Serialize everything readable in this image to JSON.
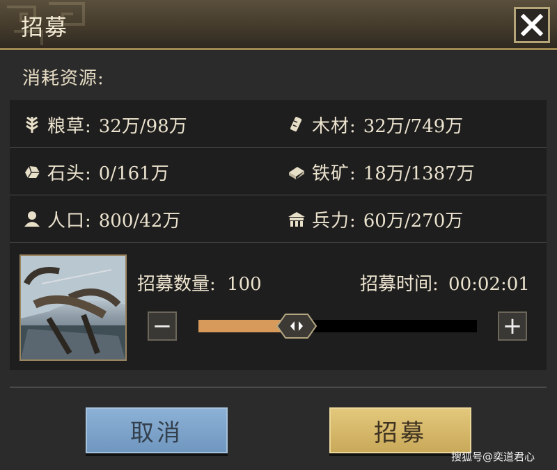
{
  "window": {
    "title": "招募",
    "close_icon": "close-icon"
  },
  "subtitle": "消耗资源:",
  "resources": [
    {
      "label": "粮草:",
      "value": "32万/98万",
      "icon": "wheat-icon"
    },
    {
      "label": "木材:",
      "value": "32万/749万",
      "icon": "wood-icon"
    },
    {
      "label": "石头:",
      "value": "0/161万",
      "icon": "stone-icon"
    },
    {
      "label": "铁矿:",
      "value": "18万/1387万",
      "icon": "iron-icon"
    },
    {
      "label": "人口:",
      "value": "800/42万",
      "icon": "person-icon"
    },
    {
      "label": "兵力:",
      "value": "60万/270万",
      "icon": "barracks-icon"
    }
  ],
  "recruit": {
    "count_label": "招募数量:",
    "count_value": "100",
    "time_label": "招募时间:",
    "time_value": "00:02:01",
    "slider_fraction": 0.3,
    "minus_label": "−",
    "plus_label": "+"
  },
  "buttons": {
    "cancel": "取消",
    "confirm": "招募"
  },
  "watermark": "搜狐号@奕道君心",
  "colors": {
    "slider_fill": "#d79a5a",
    "cancel_bg": "#7fa6cc",
    "confirm_bg": "#d8bc6c",
    "accent_border": "#a08a52"
  }
}
